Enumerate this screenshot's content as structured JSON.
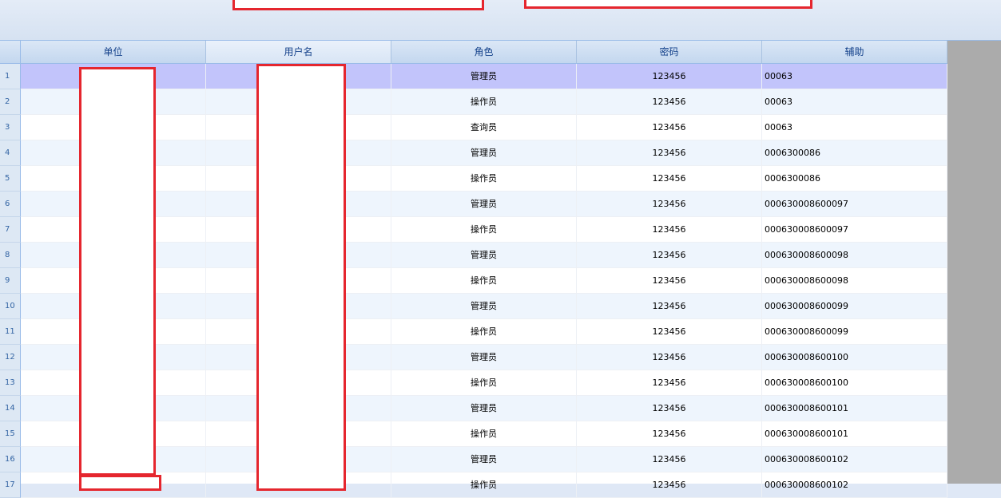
{
  "columns": [
    {
      "key": "unit",
      "label": "单位"
    },
    {
      "key": "username",
      "label": "用户名"
    },
    {
      "key": "role",
      "label": "角色"
    },
    {
      "key": "password",
      "label": "密码"
    },
    {
      "key": "aux",
      "label": "辅助"
    }
  ],
  "rows": [
    {
      "num": "1",
      "role": "管理员",
      "password": "123456",
      "aux": "00063"
    },
    {
      "num": "2",
      "role": "操作员",
      "password": "123456",
      "aux": "00063"
    },
    {
      "num": "3",
      "role": "查询员",
      "password": "123456",
      "aux": "00063"
    },
    {
      "num": "4",
      "role": "管理员",
      "password": "123456",
      "aux": "0006300086"
    },
    {
      "num": "5",
      "role": "操作员",
      "password": "123456",
      "aux": "0006300086"
    },
    {
      "num": "6",
      "role": "管理员",
      "password": "123456",
      "aux": "000630008600097"
    },
    {
      "num": "7",
      "role": "操作员",
      "password": "123456",
      "aux": "000630008600097"
    },
    {
      "num": "8",
      "role": "管理员",
      "password": "123456",
      "aux": "000630008600098"
    },
    {
      "num": "9",
      "role": "操作员",
      "password": "123456",
      "aux": "000630008600098"
    },
    {
      "num": "10",
      "role": "管理员",
      "password": "123456",
      "aux": "000630008600099"
    },
    {
      "num": "11",
      "role": "操作员",
      "password": "123456",
      "aux": "000630008600099"
    },
    {
      "num": "12",
      "role": "管理员",
      "password": "123456",
      "aux": "000630008600100"
    },
    {
      "num": "13",
      "role": "操作员",
      "password": "123456",
      "aux": "000630008600100"
    },
    {
      "num": "14",
      "role": "管理员",
      "password": "123456",
      "aux": "000630008600101"
    },
    {
      "num": "15",
      "role": "操作员",
      "password": "123456",
      "aux": "000630008600101"
    },
    {
      "num": "16",
      "role": "管理员",
      "password": "123456",
      "aux": "000630008600102"
    },
    {
      "num": "17",
      "role": "操作员",
      "password": "123456",
      "aux": "000630008600102"
    }
  ],
  "selected_row": 1,
  "colors": {
    "selected": "#c2c4fb",
    "alt": "#eef5fd",
    "redaction": "#e5262e",
    "header_text": "#15428b"
  }
}
